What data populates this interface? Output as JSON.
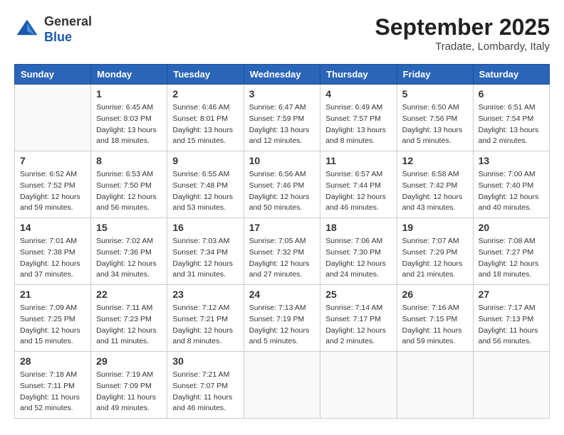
{
  "header": {
    "logo_line1": "General",
    "logo_line2": "Blue",
    "month_title": "September 2025",
    "subtitle": "Tradate, Lombardy, Italy"
  },
  "weekdays": [
    "Sunday",
    "Monday",
    "Tuesday",
    "Wednesday",
    "Thursday",
    "Friday",
    "Saturday"
  ],
  "weeks": [
    [
      {
        "day": "",
        "sunrise": "",
        "sunset": "",
        "daylight": ""
      },
      {
        "day": "1",
        "sunrise": "Sunrise: 6:45 AM",
        "sunset": "Sunset: 8:03 PM",
        "daylight": "Daylight: 13 hours and 18 minutes."
      },
      {
        "day": "2",
        "sunrise": "Sunrise: 6:46 AM",
        "sunset": "Sunset: 8:01 PM",
        "daylight": "Daylight: 13 hours and 15 minutes."
      },
      {
        "day": "3",
        "sunrise": "Sunrise: 6:47 AM",
        "sunset": "Sunset: 7:59 PM",
        "daylight": "Daylight: 13 hours and 12 minutes."
      },
      {
        "day": "4",
        "sunrise": "Sunrise: 6:49 AM",
        "sunset": "Sunset: 7:57 PM",
        "daylight": "Daylight: 13 hours and 8 minutes."
      },
      {
        "day": "5",
        "sunrise": "Sunrise: 6:50 AM",
        "sunset": "Sunset: 7:56 PM",
        "daylight": "Daylight: 13 hours and 5 minutes."
      },
      {
        "day": "6",
        "sunrise": "Sunrise: 6:51 AM",
        "sunset": "Sunset: 7:54 PM",
        "daylight": "Daylight: 13 hours and 2 minutes."
      }
    ],
    [
      {
        "day": "7",
        "sunrise": "Sunrise: 6:52 AM",
        "sunset": "Sunset: 7:52 PM",
        "daylight": "Daylight: 12 hours and 59 minutes."
      },
      {
        "day": "8",
        "sunrise": "Sunrise: 6:53 AM",
        "sunset": "Sunset: 7:50 PM",
        "daylight": "Daylight: 12 hours and 56 minutes."
      },
      {
        "day": "9",
        "sunrise": "Sunrise: 6:55 AM",
        "sunset": "Sunset: 7:48 PM",
        "daylight": "Daylight: 12 hours and 53 minutes."
      },
      {
        "day": "10",
        "sunrise": "Sunrise: 6:56 AM",
        "sunset": "Sunset: 7:46 PM",
        "daylight": "Daylight: 12 hours and 50 minutes."
      },
      {
        "day": "11",
        "sunrise": "Sunrise: 6:57 AM",
        "sunset": "Sunset: 7:44 PM",
        "daylight": "Daylight: 12 hours and 46 minutes."
      },
      {
        "day": "12",
        "sunrise": "Sunrise: 6:58 AM",
        "sunset": "Sunset: 7:42 PM",
        "daylight": "Daylight: 12 hours and 43 minutes."
      },
      {
        "day": "13",
        "sunrise": "Sunrise: 7:00 AM",
        "sunset": "Sunset: 7:40 PM",
        "daylight": "Daylight: 12 hours and 40 minutes."
      }
    ],
    [
      {
        "day": "14",
        "sunrise": "Sunrise: 7:01 AM",
        "sunset": "Sunset: 7:38 PM",
        "daylight": "Daylight: 12 hours and 37 minutes."
      },
      {
        "day": "15",
        "sunrise": "Sunrise: 7:02 AM",
        "sunset": "Sunset: 7:36 PM",
        "daylight": "Daylight: 12 hours and 34 minutes."
      },
      {
        "day": "16",
        "sunrise": "Sunrise: 7:03 AM",
        "sunset": "Sunset: 7:34 PM",
        "daylight": "Daylight: 12 hours and 31 minutes."
      },
      {
        "day": "17",
        "sunrise": "Sunrise: 7:05 AM",
        "sunset": "Sunset: 7:32 PM",
        "daylight": "Daylight: 12 hours and 27 minutes."
      },
      {
        "day": "18",
        "sunrise": "Sunrise: 7:06 AM",
        "sunset": "Sunset: 7:30 PM",
        "daylight": "Daylight: 12 hours and 24 minutes."
      },
      {
        "day": "19",
        "sunrise": "Sunrise: 7:07 AM",
        "sunset": "Sunset: 7:29 PM",
        "daylight": "Daylight: 12 hours and 21 minutes."
      },
      {
        "day": "20",
        "sunrise": "Sunrise: 7:08 AM",
        "sunset": "Sunset: 7:27 PM",
        "daylight": "Daylight: 12 hours and 18 minutes."
      }
    ],
    [
      {
        "day": "21",
        "sunrise": "Sunrise: 7:09 AM",
        "sunset": "Sunset: 7:25 PM",
        "daylight": "Daylight: 12 hours and 15 minutes."
      },
      {
        "day": "22",
        "sunrise": "Sunrise: 7:11 AM",
        "sunset": "Sunset: 7:23 PM",
        "daylight": "Daylight: 12 hours and 11 minutes."
      },
      {
        "day": "23",
        "sunrise": "Sunrise: 7:12 AM",
        "sunset": "Sunset: 7:21 PM",
        "daylight": "Daylight: 12 hours and 8 minutes."
      },
      {
        "day": "24",
        "sunrise": "Sunrise: 7:13 AM",
        "sunset": "Sunset: 7:19 PM",
        "daylight": "Daylight: 12 hours and 5 minutes."
      },
      {
        "day": "25",
        "sunrise": "Sunrise: 7:14 AM",
        "sunset": "Sunset: 7:17 PM",
        "daylight": "Daylight: 12 hours and 2 minutes."
      },
      {
        "day": "26",
        "sunrise": "Sunrise: 7:16 AM",
        "sunset": "Sunset: 7:15 PM",
        "daylight": "Daylight: 11 hours and 59 minutes."
      },
      {
        "day": "27",
        "sunrise": "Sunrise: 7:17 AM",
        "sunset": "Sunset: 7:13 PM",
        "daylight": "Daylight: 11 hours and 56 minutes."
      }
    ],
    [
      {
        "day": "28",
        "sunrise": "Sunrise: 7:18 AM",
        "sunset": "Sunset: 7:11 PM",
        "daylight": "Daylight: 11 hours and 52 minutes."
      },
      {
        "day": "29",
        "sunrise": "Sunrise: 7:19 AM",
        "sunset": "Sunset: 7:09 PM",
        "daylight": "Daylight: 11 hours and 49 minutes."
      },
      {
        "day": "30",
        "sunrise": "Sunrise: 7:21 AM",
        "sunset": "Sunset: 7:07 PM",
        "daylight": "Daylight: 11 hours and 46 minutes."
      },
      {
        "day": "",
        "sunrise": "",
        "sunset": "",
        "daylight": ""
      },
      {
        "day": "",
        "sunrise": "",
        "sunset": "",
        "daylight": ""
      },
      {
        "day": "",
        "sunrise": "",
        "sunset": "",
        "daylight": ""
      },
      {
        "day": "",
        "sunrise": "",
        "sunset": "",
        "daylight": ""
      }
    ]
  ]
}
